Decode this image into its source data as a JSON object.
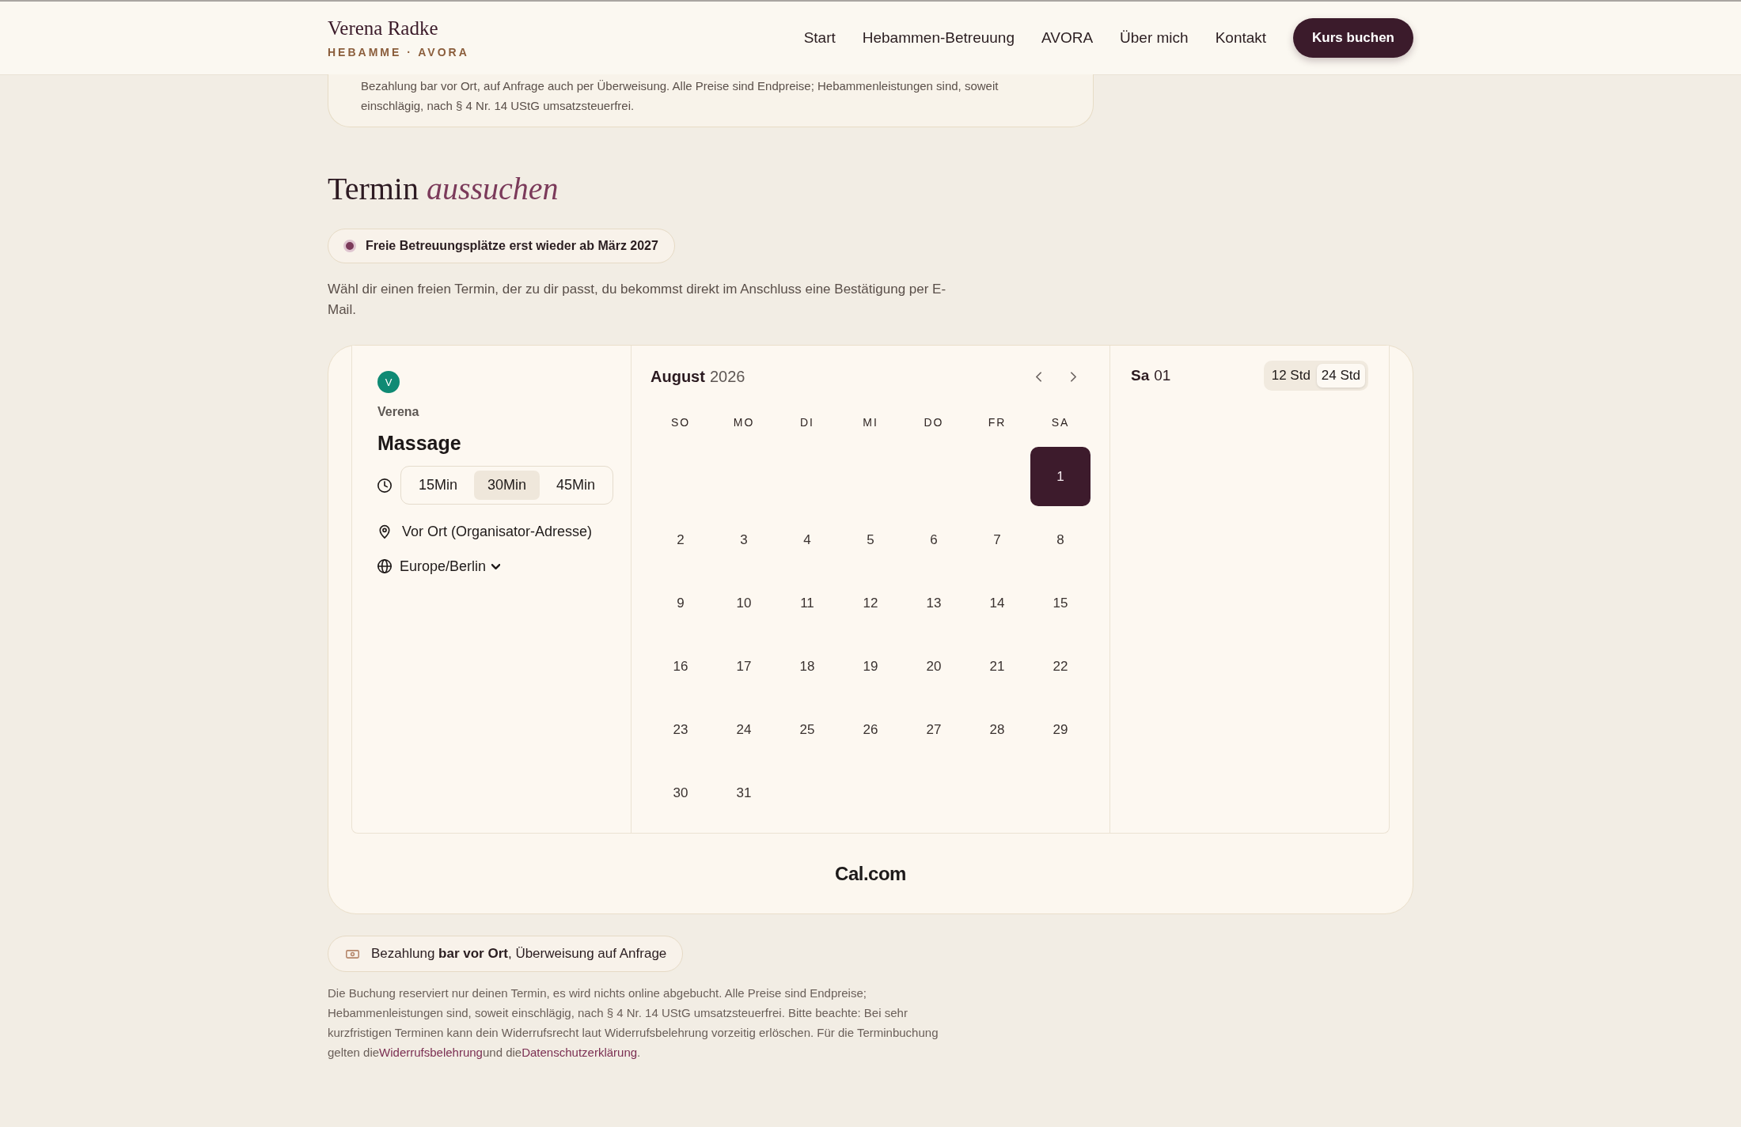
{
  "header": {
    "brand": {
      "name": "Verena Radke",
      "tagline": "HEBAMME · AVORA"
    },
    "nav": [
      {
        "label": "Start"
      },
      {
        "label": "Hebammen-Betreuung"
      },
      {
        "label": "AVORA"
      },
      {
        "label": "Über mich"
      },
      {
        "label": "Kontakt"
      }
    ],
    "cta": "Kurs buchen"
  },
  "payment_info": {
    "text": "Bezahlung bar vor Ort, auf Anfrage auch per Überweisung. Alle Preise sind Endpreise; Hebammenleistungen sind, soweit einschlägig, nach § 4 Nr. 14 UStG umsatzsteuerfrei."
  },
  "booking_section": {
    "title": "Termin *aussuchen*",
    "availability_badge": "Freie Betreuungsplätze erst wieder ab März 2027",
    "intro": "Wähl dir einen freien Termin, der zu dir passt, du bekommst direkt im Anschluss eine Bestätigung per E-Mail.",
    "booker": {
      "host": {
        "initial": "V",
        "name": "Verena"
      },
      "event_title": "Massage",
      "durations": [
        {
          "label": "15Min",
          "selected": false
        },
        {
          "label": "30Min",
          "selected": true
        },
        {
          "label": "45Min",
          "selected": false
        }
      ],
      "location": "Vor Ort (Organisator-Adresse)",
      "timezone": "Europe/Berlin",
      "calendar": {
        "month": "August",
        "year": "2026",
        "weekdays": [
          "SO",
          "MO",
          "DI",
          "MI",
          "DO",
          "FR",
          "SA"
        ],
        "weeks": [
          [
            {
              "day": "1",
              "selected": true
            }
          ],
          [
            {
              "day": "2",
              "selected": false
            },
            {
              "day": "3",
              "selected": false
            },
            {
              "day": "4",
              "selected": false
            },
            {
              "day": "5",
              "selected": false
            },
            {
              "day": "6",
              "selected": false
            },
            {
              "day": "7",
              "selected": false
            },
            {
              "day": "8",
              "selected": false
            }
          ],
          [
            {
              "day": "9",
              "selected": false
            },
            {
              "day": "10",
              "selected": false
            },
            {
              "day": "11",
              "selected": false
            },
            {
              "day": "12",
              "selected": false
            },
            {
              "day": "13",
              "selected": false
            },
            {
              "day": "14",
              "selected": false
            },
            {
              "day": "15",
              "selected": false
            }
          ],
          [
            {
              "day": "16",
              "selected": false
            },
            {
              "day": "17",
              "selected": false
            },
            {
              "day": "18",
              "selected": false
            },
            {
              "day": "19",
              "selected": false
            },
            {
              "day": "20",
              "selected": false
            },
            {
              "day": "21",
              "selected": false
            },
            {
              "day": "22",
              "selected": false
            }
          ],
          [
            {
              "day": "23",
              "selected": false
            },
            {
              "day": "24",
              "selected": false
            },
            {
              "day": "25",
              "selected": false
            },
            {
              "day": "26",
              "selected": false
            },
            {
              "day": "27",
              "selected": false
            },
            {
              "day": "28",
              "selected": false
            },
            {
              "day": "29",
              "selected": false
            }
          ],
          [
            {
              "day": "30",
              "selected": false
            },
            {
              "day": "31",
              "selected": false
            }
          ]
        ]
      },
      "day_panel": {
        "weekday": "Sa",
        "date": "01",
        "time_formats": [
          {
            "label": "12 Std",
            "selected": false
          },
          {
            "label": "24 Std",
            "selected": true
          }
        ]
      },
      "footer_logo": "Cal.com"
    },
    "payment_badge": "Bezahlung **bar vor Ort**, Überweisung auf Anfrage",
    "fine_print": [
      {
        "kind": "text",
        "text": "Die Buchung reserviert nur deinen Termin, es wird nichts online abgebucht. Alle Preise sind Endpreise; Hebammenleistungen sind, soweit einschlägig, nach § 4 Nr. 14 UStG umsatzsteuerfrei. Bitte beachte: Bei sehr kurzfristigen Terminen kann dein Widerrufsrecht laut Widerrufsbelehrung vorzeitig erlöschen. Für die Terminbuchung gelten die"
      },
      {
        "kind": "link",
        "text": "Widerrufsbelehrung"
      },
      {
        "kind": "text",
        "text": "und die"
      },
      {
        "kind": "link",
        "text": "Datenschutzerklärung"
      },
      {
        "kind": "text",
        "text": "."
      }
    ]
  }
}
